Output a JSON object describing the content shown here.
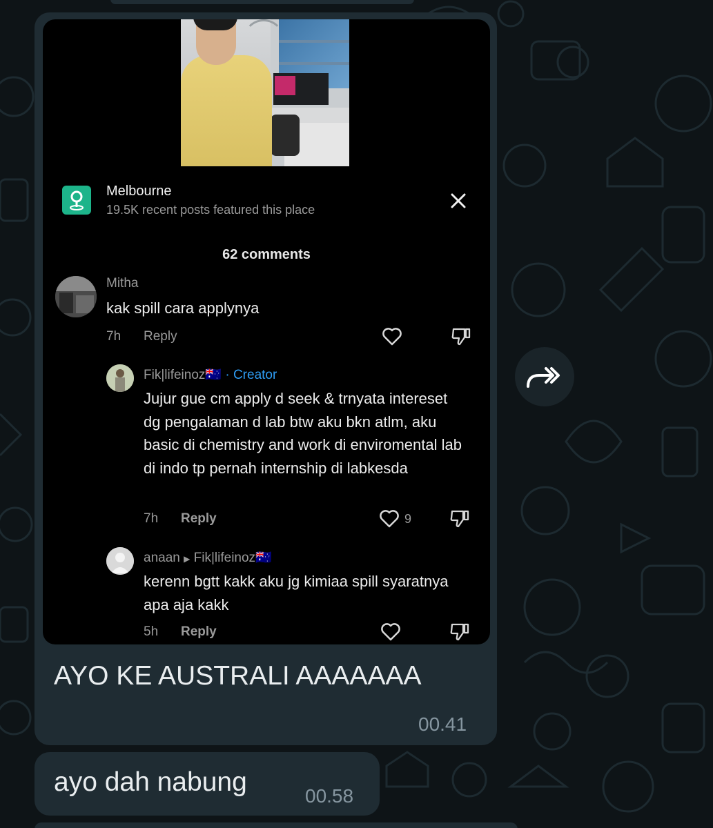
{
  "colors": {
    "background": "#0e1417",
    "bubble": "#1f2c33",
    "location_icon": "#1db48a",
    "creator": "#2f9df4",
    "time": "#8696a0"
  },
  "screenshot": {
    "location": {
      "icon": "map-pin-icon",
      "name": "Melbourne",
      "subtitle": "19.5K recent posts featured this place"
    },
    "comments_count": "62 comments",
    "comments": [
      {
        "author": "Mitha",
        "text": "kak spill cara applynya",
        "age": "7h",
        "reply": "Reply"
      },
      {
        "author": "Fik|lifeinoz🇦🇺",
        "badge": "· Creator",
        "text": "Jujur gue cm apply d seek & trnyata intereset dg pengalaman d lab btw aku bkn atlm, aku basic di chemistry and work di enviromental lab di indo tp pernah internship di labkesda",
        "age": "7h",
        "reply": "Reply",
        "likes": "9"
      },
      {
        "author": "anaan",
        "reply_to": "Fik|lifeinoz🇦🇺",
        "text": "kerenn bgtt kakk aku jg kimiaa spill syaratnya apa aja kakk",
        "age": "5h",
        "reply": "Reply"
      }
    ]
  },
  "messages": [
    {
      "text": "AYO KE AUSTRALI AAAAAAA",
      "time": "00.41"
    },
    {
      "text": "ayo dah nabung",
      "time": "00.58"
    }
  ],
  "icons": {
    "forward": "forward-icon",
    "close": "close-icon",
    "heart": "heart-icon",
    "dislike": "dislike-icon"
  }
}
